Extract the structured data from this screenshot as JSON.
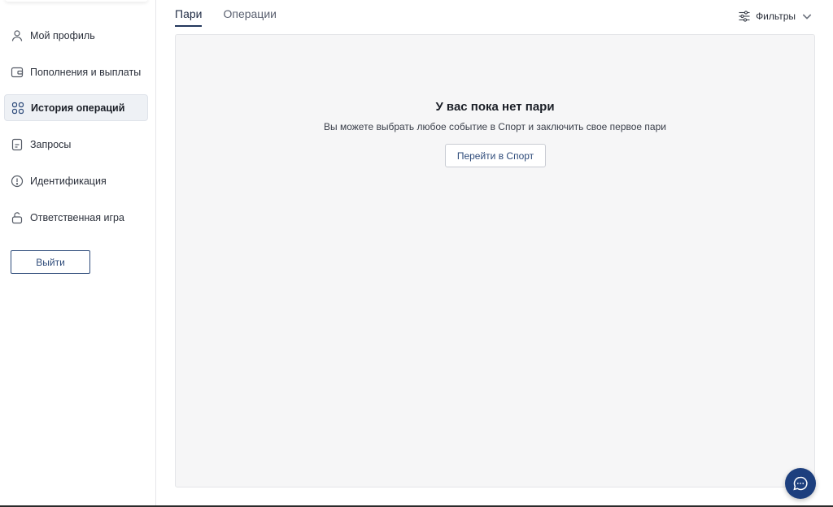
{
  "sidebar": {
    "items": [
      {
        "label": "Мой профиль",
        "icon": "user-icon"
      },
      {
        "label": "Пополнения и выплаты",
        "icon": "wallet-icon"
      },
      {
        "label": "История операций",
        "icon": "grid-icon",
        "active": true
      },
      {
        "label": "Запросы",
        "icon": "document-icon"
      },
      {
        "label": "Идентификация",
        "icon": "alert-circle-icon"
      },
      {
        "label": "Ответственная игра",
        "icon": "lock-icon"
      }
    ],
    "logout_label": "Выйти"
  },
  "tabs": [
    {
      "label": "Пари",
      "active": true
    },
    {
      "label": "Операции",
      "active": false
    }
  ],
  "filters": {
    "label": "Фильтры",
    "icon": "sliders-icon"
  },
  "empty_state": {
    "title": "У вас пока нет пари",
    "text": "Вы можете выбрать любое событие в Спорт и заключить свое первое пари",
    "button_label": "Перейти в Спорт"
  },
  "chat": {
    "icon": "chat-bubble-icon"
  },
  "colors": {
    "accent": "#22375c",
    "chat_bg": "#1d3f7e",
    "panel_bg": "#f6f6f7",
    "active_nav_bg": "#eef1f5"
  }
}
